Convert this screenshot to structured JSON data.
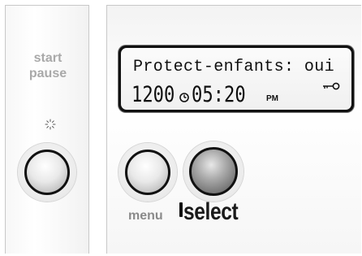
{
  "left_panel": {
    "label_line1": "start",
    "label_line2": "pause",
    "indicator_icon": "sparkle-indicator-icon"
  },
  "display": {
    "line1": "Protect-enfants: oui",
    "channel": "1200",
    "clock_icon": "clock-icon",
    "time": "05:20",
    "ampm": "PM",
    "lock_icon": "key-icon"
  },
  "buttons": {
    "menu_label": "menu",
    "select_label": "select"
  },
  "colors": {
    "lcd_frame": "#111111",
    "lcd_background": "#f4f4f4",
    "label_grey": "#a9a9a9",
    "select_text": "#1a1a1a"
  }
}
